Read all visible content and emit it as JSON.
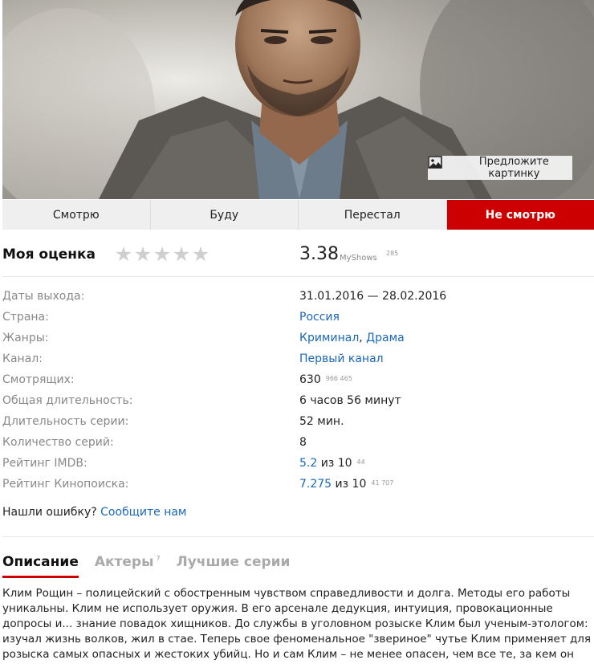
{
  "hero": {
    "suggest_label": "Предложите картинку"
  },
  "status_buttons": [
    {
      "label": "Смотрю"
    },
    {
      "label": "Буду"
    },
    {
      "label": "Перестал"
    },
    {
      "label": "Не смотрю"
    }
  ],
  "rating": {
    "my_label": "Моя оценка",
    "stars_total": 5,
    "stars_filled": 0,
    "score": "3.38",
    "source": "MyShows",
    "votes": "285"
  },
  "info": {
    "dates_label": "Даты выхода:",
    "dates_value": "31.01.2016 — 28.02.2016",
    "country_label": "Страна:",
    "country_value": "Россия",
    "genres_label": "Жанры:",
    "genre_1": "Криминал",
    "genre_sep": ", ",
    "genre_2": "Драма",
    "channel_label": "Канал:",
    "channel_value": "Первый канал",
    "watchers_label": "Смотрящих:",
    "watchers_value": "630",
    "watchers_extra": "966 465",
    "total_label": "Общая длительность:",
    "total_value": "6 часов 56 минут",
    "ep_label": "Длительность серии:",
    "ep_value": "52 мин.",
    "count_label": "Количество серий:",
    "count_value": "8",
    "imdb_label": "Рейтинг IMDB:",
    "imdb_value": "5.2",
    "imdb_of": " из 10",
    "imdb_votes": "44",
    "kp_label": "Рейтинг Кинопоиска:",
    "kp_value": "7.275",
    "kp_of": " из 10",
    "kp_votes": "41 707"
  },
  "error": {
    "text": "Нашли ошибку? ",
    "link": "Сообщите нам"
  },
  "tabs": {
    "description": "Описание",
    "actors": "Актеры",
    "actors_count": "7",
    "best": "Лучшие серии"
  },
  "description": "Клим Рощин – полицейский с обостренным чувством справедливости и долга. Методы его работы уникальны. Клим не использует оружия. В его арсенале дедукция, интуиция, провокационные допросы и... знание повадок хищников. До службы в уголовном розыске Клим был ученым-этологом: изучал жизнь волков, жил в стае. Теперь свое феноменальное \"звериное\" чутье Клим применяет для розыска самых опасных и жестоких убийц. Но и сам Клим – не менее опасен, чем все те, за кем он охотится.",
  "colors": {
    "accent": "#cc0000",
    "link": "#1a67b8",
    "muted": "#888888"
  }
}
